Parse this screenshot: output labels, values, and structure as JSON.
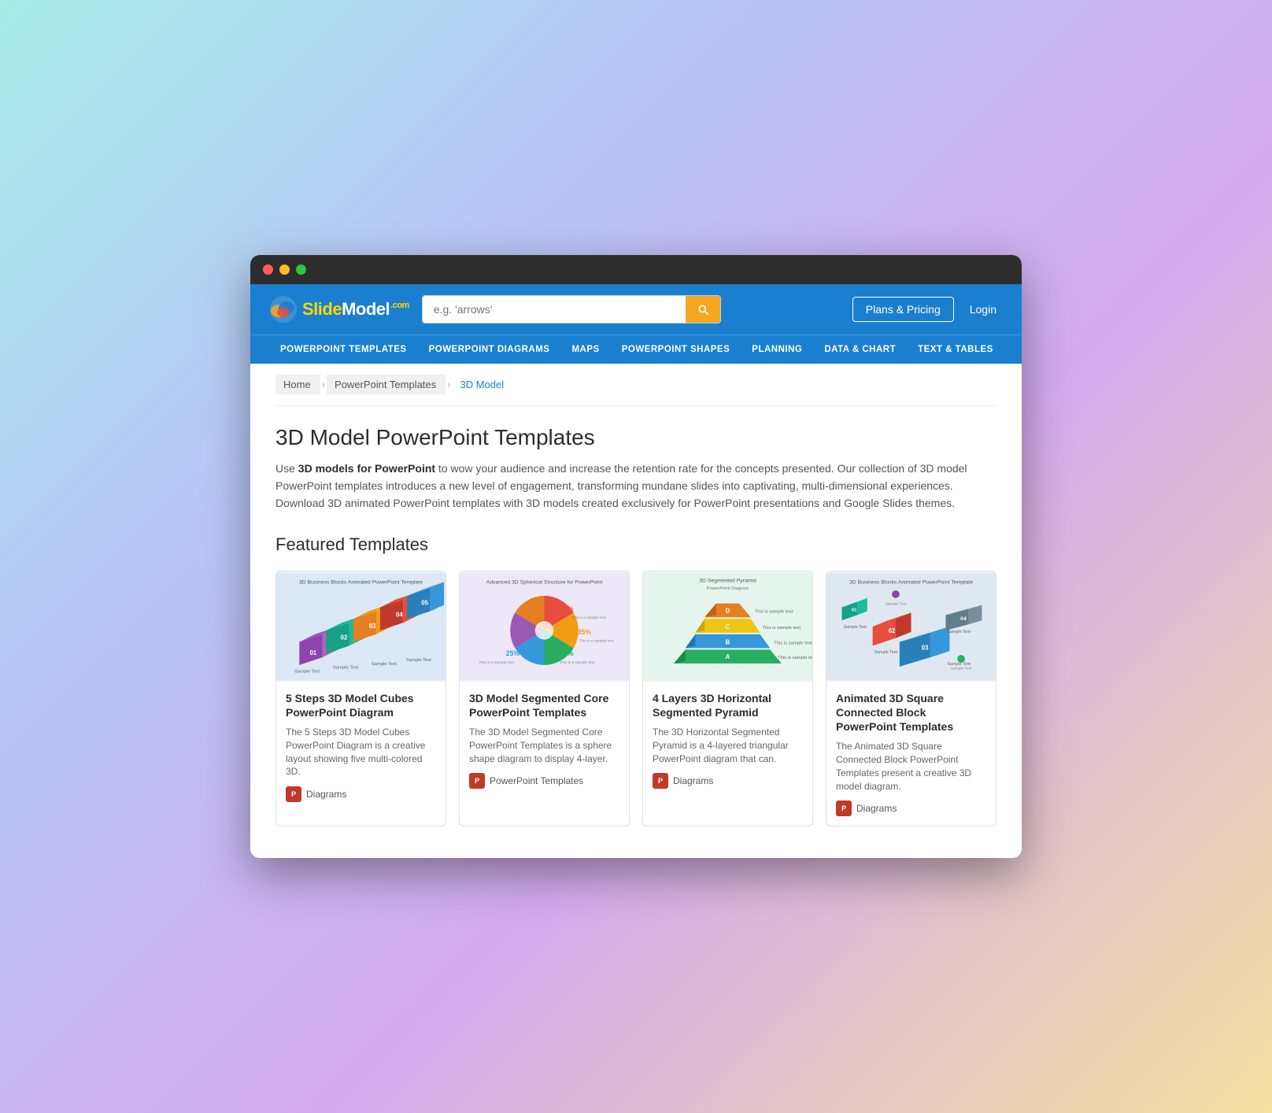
{
  "browser": {
    "dots": [
      "red",
      "yellow",
      "green"
    ]
  },
  "header": {
    "logo_text": "SlideModel",
    "logo_com": ".com",
    "search_placeholder": "e.g. 'arrows'",
    "plans_label": "Plans & Pricing",
    "login_label": "Login"
  },
  "nav": {
    "items": [
      {
        "id": "powerpoint-templates",
        "label": "POWERPOINT TEMPLATES"
      },
      {
        "id": "powerpoint-diagrams",
        "label": "POWERPOINT DIAGRAMS"
      },
      {
        "id": "maps",
        "label": "MAPS"
      },
      {
        "id": "powerpoint-shapes",
        "label": "POWERPOINT SHAPES"
      },
      {
        "id": "planning",
        "label": "PLANNING"
      },
      {
        "id": "data-chart",
        "label": "DATA & CHART"
      },
      {
        "id": "text-tables",
        "label": "TEXT & TABLES"
      }
    ]
  },
  "breadcrumb": {
    "items": [
      {
        "label": "Home",
        "active": false
      },
      {
        "label": "PowerPoint Templates",
        "active": false
      },
      {
        "label": "3D Model",
        "active": true
      }
    ]
  },
  "page": {
    "title": "3D Model PowerPoint Templates",
    "description_plain": "Use ",
    "description_bold": "3D models for PowerPoint",
    "description_rest": " to wow your audience and increase the retention rate for the concepts presented. Our collection of 3D model PowerPoint templates introduces a new level of engagement, transforming mundane slides into captivating, multi-dimensional experiences. Download 3D animated PowerPoint templates with 3D models created exclusively for PowerPoint presentations and Google Slides themes.",
    "featured_title": "Featured Templates"
  },
  "templates": [
    {
      "title": "5 Steps 3D Model Cubes PowerPoint Diagram",
      "description": "The 5 Steps 3D Model Cubes PowerPoint Diagram is a creative layout showing five multi-colored 3D.",
      "tag": "Diagrams",
      "card_type": "cubes"
    },
    {
      "title": "3D Model Segmented Core PowerPoint Templates",
      "description": "The 3D Model Segmented Core PowerPoint Templates is a sphere shape diagram to display 4-layer.",
      "tag": "PowerPoint Templates",
      "card_type": "sphere"
    },
    {
      "title": "4 Layers 3D Horizontal Segmented Pyramid",
      "description": "The 3D Horizontal Segmented Pyramid is a 4-layered triangular PowerPoint diagram that can.",
      "tag": "Diagrams",
      "card_type": "pyramid"
    },
    {
      "title": "Animated 3D Square Connected Block PowerPoint Templates",
      "description": "The Animated 3D Square Connected Block PowerPoint Templates present a creative 3D model diagram.",
      "tag": "Diagrams",
      "card_type": "blocks"
    }
  ]
}
